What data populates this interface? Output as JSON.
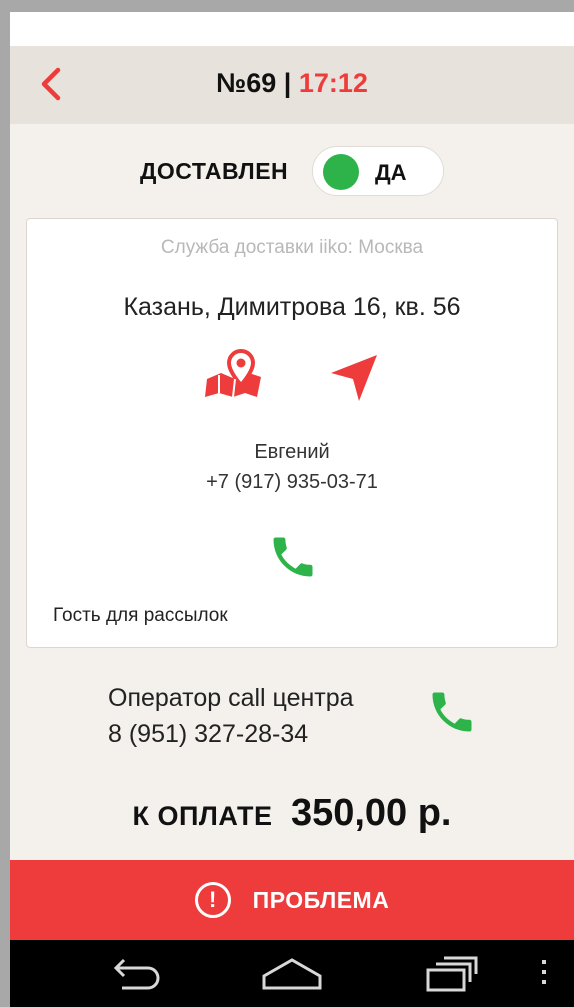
{
  "header": {
    "order_number": "№69",
    "separator": " | ",
    "time": "17:12"
  },
  "delivered": {
    "label": "ДОСТАВЛЕН",
    "toggle_label": "ДА",
    "toggle_on": true
  },
  "card": {
    "service": "Служба доставки iiko: Москва",
    "address": "Казань, Димитрова 16, кв. 56",
    "customer_name": "Евгений",
    "customer_phone": "+7 (917) 935-03-71",
    "guest_note": "Гость для рассылок"
  },
  "operator": {
    "label": "Оператор call центра",
    "phone": "8 (951) 327-28-34"
  },
  "payment": {
    "label": "К ОПЛАТЕ",
    "amount": "350,00 р."
  },
  "problem_button": {
    "icon_text": "!",
    "label": "ПРОБЛЕМА"
  },
  "colors": {
    "accent_red": "#ee3b3b",
    "green": "#2db34a",
    "header_bg": "#e8e2dc",
    "page_bg": "#f4f1ed"
  },
  "icons": [
    "back-chevron-icon",
    "map-pin-icon",
    "navigation-arrow-icon",
    "phone-icon",
    "alert-icon",
    "back-nav-icon",
    "home-nav-icon",
    "recents-nav-icon",
    "menu-dots-icon"
  ]
}
